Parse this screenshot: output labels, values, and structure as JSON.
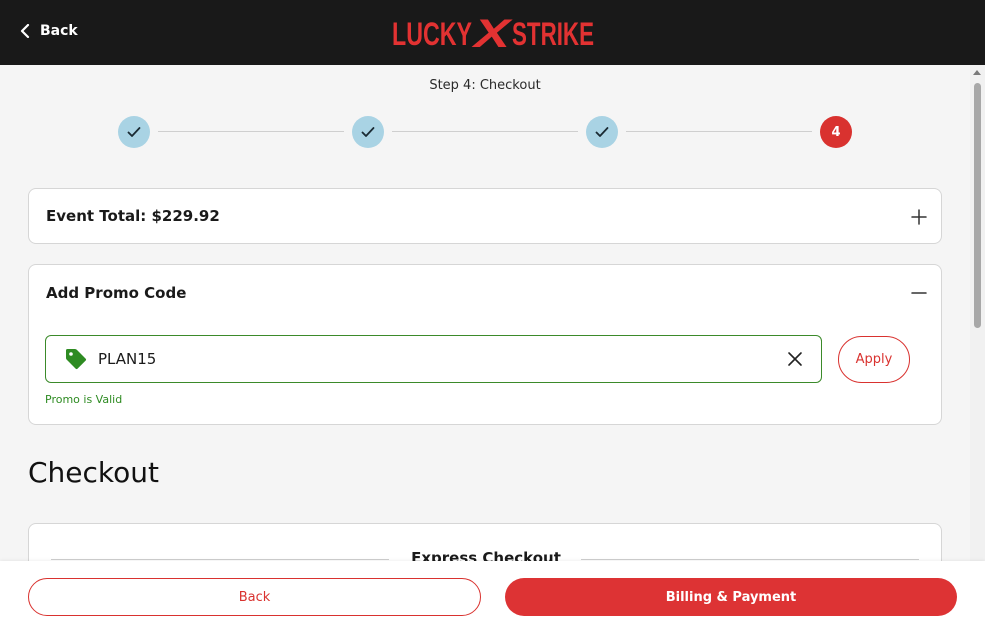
{
  "header": {
    "back_label": "Back",
    "logo_text": "LUCKY X STRIKE",
    "logo_word1": "LUCKY",
    "logo_mark": "X",
    "logo_word2": "STRIKE"
  },
  "stepper": {
    "title": "Step 4: Checkout",
    "current_step": "4",
    "steps": [
      {
        "state": "complete"
      },
      {
        "state": "complete"
      },
      {
        "state": "complete"
      },
      {
        "state": "current",
        "label": "4"
      }
    ]
  },
  "event_total": {
    "label": "Event Total: $229.92",
    "toggle_icon": "plus-icon"
  },
  "promo": {
    "title": "Add Promo Code",
    "toggle_icon": "minus-icon",
    "code_value": "PLAN15",
    "apply_label": "Apply",
    "status_text": "Promo is Valid"
  },
  "checkout": {
    "heading": "Checkout",
    "express_label": "Express Checkout"
  },
  "footer": {
    "back_label": "Back",
    "next_label": "Billing & Payment"
  },
  "colors": {
    "brand_red": "#d9322f",
    "header_bg": "#191919",
    "step_done": "#a9d3e4",
    "valid_green": "#2e8b22"
  }
}
